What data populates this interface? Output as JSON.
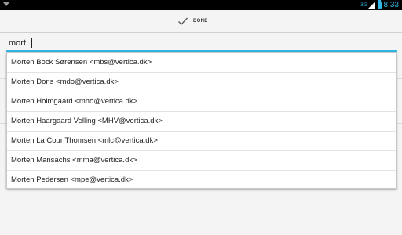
{
  "status_bar": {
    "network": "3G",
    "time": "8:33",
    "accent_color": "#33b5e5"
  },
  "action_bar": {
    "done_label": "DONE",
    "done_icon": "checkmark-icon"
  },
  "search": {
    "value": "mort"
  },
  "suggestions": [
    "Morten Bock Sørensen  <mbs@vertica.dk>",
    "Morten Dons  <mdo@vertica.dk>",
    "Morten Holmgaard  <mho@vertica.dk>",
    "Morten Haargaard Velling  <MHV@vertica.dk>",
    "Morten La Cour Thomsen  <mlc@vertica.dk>",
    "Morten Mansachs  <mma@vertica.dk>",
    "Morten Pedersen  <mpe@vertica.dk>"
  ]
}
